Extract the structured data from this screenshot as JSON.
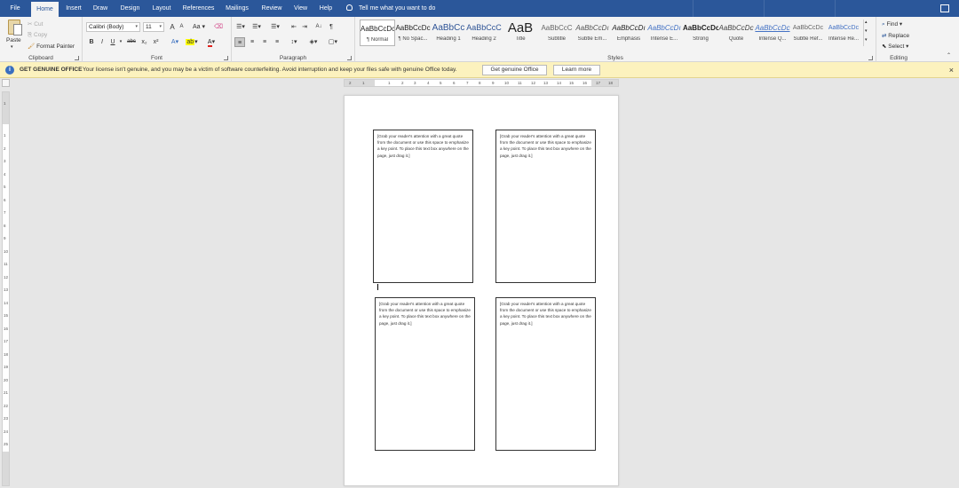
{
  "tabs": [
    "File",
    "Home",
    "Insert",
    "Draw",
    "Design",
    "Layout",
    "References",
    "Mailings",
    "Review",
    "View",
    "Help"
  ],
  "tell_me": "Tell me what you want to do",
  "clipboard": {
    "paste": "Paste",
    "cut": "Cut",
    "copy": "Copy",
    "format_painter": "Format Painter",
    "label": "Clipboard"
  },
  "font": {
    "name": "Calibri (Body)",
    "size": "11",
    "grow": "A",
    "shrink": "A",
    "case": "Aa",
    "bold": "B",
    "italic": "I",
    "underline": "U",
    "strike": "abc",
    "subscript": "x₂",
    "superscript": "x²",
    "font_color": "A",
    "label": "Font"
  },
  "paragraph": {
    "show_marks": "¶",
    "label": "Paragraph"
  },
  "styles": {
    "items": [
      {
        "sample": "AaBbCcDc",
        "name": "¶ Normal"
      },
      {
        "sample": "AaBbCcDc",
        "name": "¶ No Spac..."
      },
      {
        "sample": "AaBbCc",
        "name": "Heading 1"
      },
      {
        "sample": "AaBbCcC",
        "name": "Heading 2"
      },
      {
        "sample": "AaB",
        "name": "Title"
      },
      {
        "sample": "AaBbCcC",
        "name": "Subtitle"
      },
      {
        "sample": "AaBbCcDı",
        "name": "Subtle Em..."
      },
      {
        "sample": "AaBbCcDı",
        "name": "Emphasis"
      },
      {
        "sample": "AaBbCcDı",
        "name": "Intense E..."
      },
      {
        "sample": "AaBbCcDc",
        "name": "Strong"
      },
      {
        "sample": "AaBbCcDc",
        "name": "Quote"
      },
      {
        "sample": "AaBbCcDc",
        "name": "Intense Q..."
      },
      {
        "sample": "AaBbCcDc",
        "name": "Subtle Ref..."
      },
      {
        "sample": "AaBbCcDc",
        "name": "Intense Re..."
      }
    ],
    "label": "Styles"
  },
  "editing": {
    "find": "Find",
    "replace": "Replace",
    "select": "Select",
    "label": "Editing"
  },
  "notification": {
    "icon": "i",
    "title": "GET GENUINE OFFICE",
    "message": "Your license isn't genuine, and you may be a victim of software counterfeiting. Avoid interruption and keep your files safe with genuine Office today.",
    "primary_button": "Get genuine Office",
    "secondary_button": "Learn more",
    "close": "×"
  },
  "ruler": {
    "horizontal": [
      "2",
      "1",
      "1",
      "2",
      "3",
      "4",
      "5",
      "6",
      "7",
      "8",
      "9",
      "10",
      "11",
      "12",
      "13",
      "14",
      "15",
      "16",
      "17",
      "18"
    ],
    "vertical": [
      "1",
      "1",
      "2",
      "3",
      "4",
      "5",
      "6",
      "7",
      "8",
      "9",
      "10",
      "11",
      "12",
      "13",
      "14",
      "15",
      "16",
      "17",
      "18",
      "19",
      "20",
      "21",
      "22",
      "23",
      "24",
      "25"
    ]
  },
  "document": {
    "textboxes": [
      "[Grab your reader's attention with a great quote from the document or use this space to emphasize a key point. To place this text box anywhere on the page, just drag it.]",
      "[Grab your reader's attention with a great quote from the document or use this space to emphasize a key point. To place this text box anywhere on the page, just drag it.]",
      "[Grab your reader's attention with a great quote from the document or use this space to emphasize a key point. To place this text box anywhere on the page, just drag it.]",
      "[Grab your reader's attention with a great quote from the document or use this space to emphasize a key point. To place this text box anywhere on the page, just drag it.]"
    ]
  },
  "colors": {
    "ribbon_blue": "#2b579a",
    "notification_bg": "#fcf2be",
    "font_color_red": "#e0201b",
    "highlight_yellow": "#ffff00"
  }
}
